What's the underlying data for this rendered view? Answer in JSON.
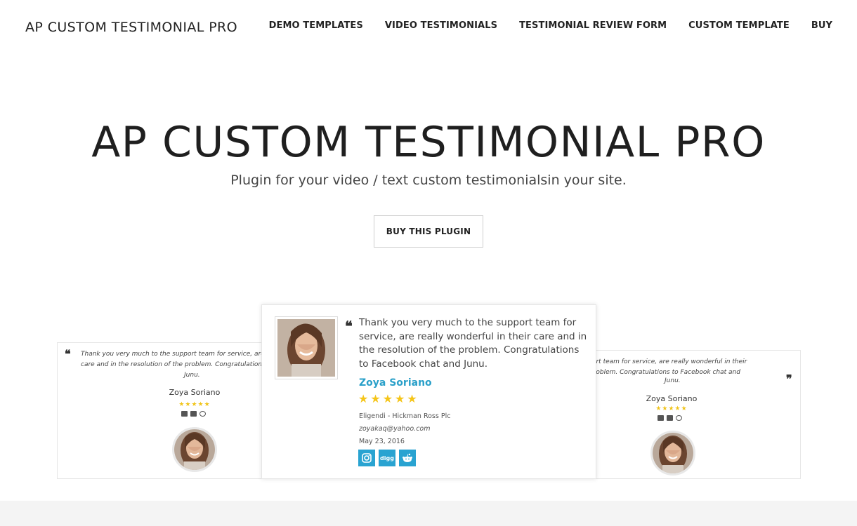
{
  "header": {
    "brand": "AP CUSTOM TESTIMONIAL PRO",
    "nav": [
      {
        "label": "DEMO TEMPLATES"
      },
      {
        "label": "VIDEO TESTIMONIALS"
      },
      {
        "label": "TESTIMONIAL REVIEW FORM"
      },
      {
        "label": "CUSTOM TEMPLATE"
      },
      {
        "label": "BUY"
      }
    ]
  },
  "hero": {
    "title": "AP CUSTOM TESTIMONIAL PRO",
    "subtitle": "Plugin for your video / text custom testimonialsin your site.",
    "button_label": "BUY THIS PLUGIN"
  },
  "cards": {
    "left": {
      "line1": "Thank you very much to the support team for service, are really wonderful in their",
      "line2": "care and in the resolution of the problem. Congratulations to Facebook chat and",
      "line3": "Junu.",
      "name": "Zoya Soriano",
      "stars": "★★★★★"
    },
    "center": {
      "text": "Thank you very much to the support team for service, are really wonderful in their care and in the resolution of the problem. Congratulations to Facebook chat and Junu.",
      "name": "Zoya Soriano",
      "stars": "★★★★★",
      "company": "Eligendi -  Hickman Ross Plc",
      "email": "zoyakaq@yahoo.com",
      "date": "May 23, 2016",
      "social": [
        "instagram-icon",
        "digg-icon",
        "reddit-icon"
      ]
    },
    "right": {
      "line1": "Thank you very much to the support team for service, are really wonderful in their",
      "line2": "care and in the resolution of the problem. Congratulations to Facebook chat and",
      "line3": "Junu.",
      "name": "Zoya Soriano",
      "stars": "★★★★★"
    }
  },
  "colors": {
    "accent": "#29a3d1",
    "star": "#f5c518",
    "footer": "#f4f4f4"
  }
}
